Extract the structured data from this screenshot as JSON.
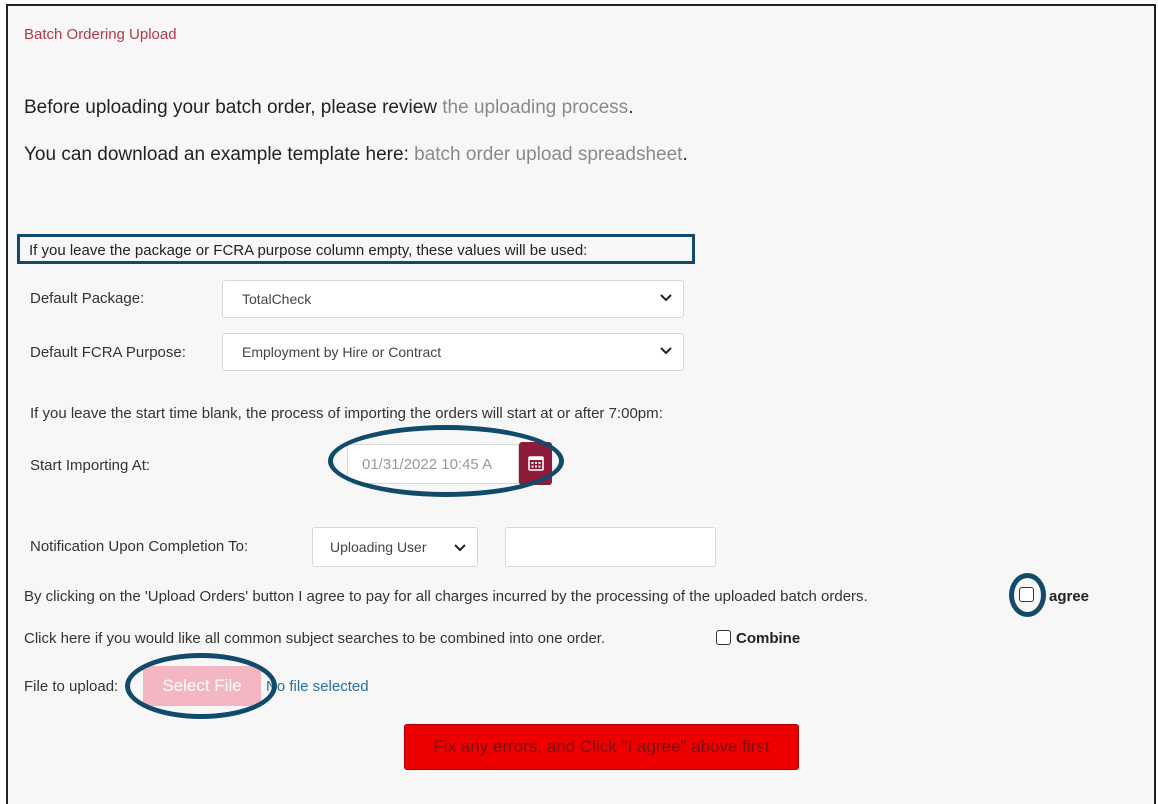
{
  "panel": {
    "title": "Batch Ordering Upload"
  },
  "intro": {
    "review_text": "Before uploading your batch order, please review ",
    "review_link": "the uploading process",
    "review_end": ".",
    "template_text": "You can download an example template here: ",
    "template_link": "batch order upload spreadsheet",
    "template_end": "."
  },
  "defaults": {
    "notice": "If you leave the package or FCRA purpose column empty, these values will be used:",
    "package_label": "Default Package:",
    "package_value": "TotalCheck",
    "purpose_label": "Default FCRA Purpose:",
    "purpose_value": "Employment by Hire or Contract"
  },
  "schedule": {
    "notice": "If you leave the start time blank, the process of importing the orders will start at or after 7:00pm:",
    "start_label": "Start Importing At:",
    "start_value": "01/31/2022 10:45 A"
  },
  "notification": {
    "label": "Notification Upon Completion To:",
    "select_value": "Uploading User",
    "input_value": ""
  },
  "agreement": {
    "text": "By clicking on the 'Upload Orders' button I agree to pay for all charges incurred by the processing of the uploaded batch orders.",
    "checkbox_label": "agree"
  },
  "combine": {
    "text": "Click here if you would like all common subject searches to be combined into one order.",
    "checkbox_label": "Combine"
  },
  "file": {
    "label": "File to upload:",
    "button_label": "Select File",
    "status": "No file selected"
  },
  "submit": {
    "label": "Fix any errors, and Click \"I agree\" above first"
  },
  "colors": {
    "accent": "#8e1b3b",
    "highlight": "#124a6b",
    "error_button": "#ee0000",
    "file_button": "#f4b6c2"
  },
  "icons": [
    "chevron-down-icon",
    "calendar-icon"
  ]
}
